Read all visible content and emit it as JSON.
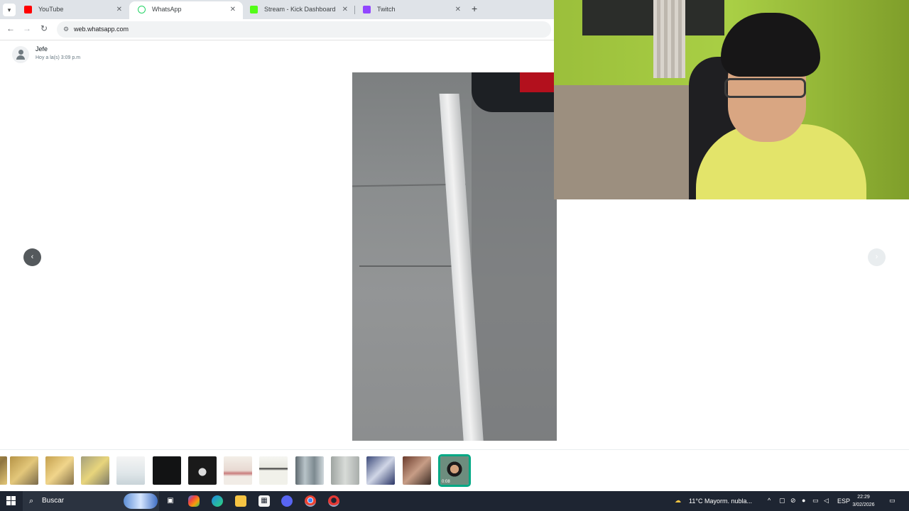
{
  "browser": {
    "tabs": [
      {
        "label": "YouTube",
        "favicon_color": "#ff0000",
        "active": false
      },
      {
        "label": "WhatsApp",
        "favicon_color": "#25d366",
        "active": true
      },
      {
        "label": "Stream - Kick Dashboard",
        "favicon_color": "#53fc18",
        "active": false
      },
      {
        "label": "Twitch",
        "favicon_color": "#9146ff",
        "active": false
      }
    ],
    "address": "web.whatsapp.com"
  },
  "media_viewer": {
    "contact_name": "Jefe",
    "timestamp": "Hoy a la(s) 3:09 p.m",
    "thumbnail_count": 13,
    "selected_thumbnail_badge": "0:08"
  },
  "taskbar": {
    "search_placeholder": "Buscar",
    "weather": "11°C  Mayorm. nubla...",
    "language": "ESP",
    "time": "22:29",
    "date": "3/02/2026"
  },
  "colors": {
    "accent": "#00a884",
    "taskbar": "#1e2532",
    "tabstrip": "#dfe3e8"
  }
}
